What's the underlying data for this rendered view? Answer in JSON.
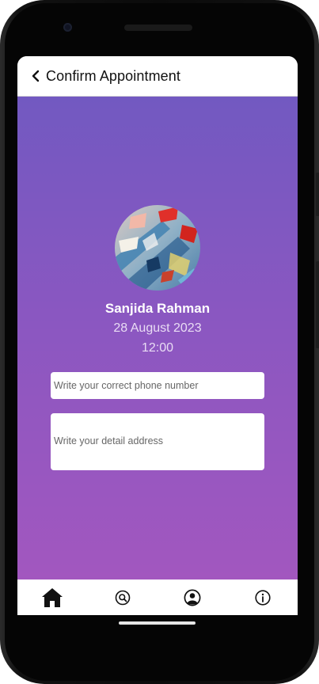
{
  "app_bar": {
    "title": "Confirm Appointment",
    "back_icon": "chevron-left-icon"
  },
  "profile": {
    "name": "Sanjida Rahman",
    "date": "28 August 2023",
    "time": "12:00"
  },
  "form": {
    "phone_placeholder": "Write your correct phone number",
    "address_placeholder": "Write your detail address"
  },
  "bottom_nav": [
    {
      "icon": "home-icon",
      "active": true
    },
    {
      "icon": "search-icon",
      "active": false
    },
    {
      "icon": "profile-icon",
      "active": false
    },
    {
      "icon": "info-icon",
      "active": false
    }
  ],
  "colors": {
    "gradient_top": "#7259c1",
    "gradient_bottom": "#a257bf",
    "text_light": "#e9dcf4"
  }
}
